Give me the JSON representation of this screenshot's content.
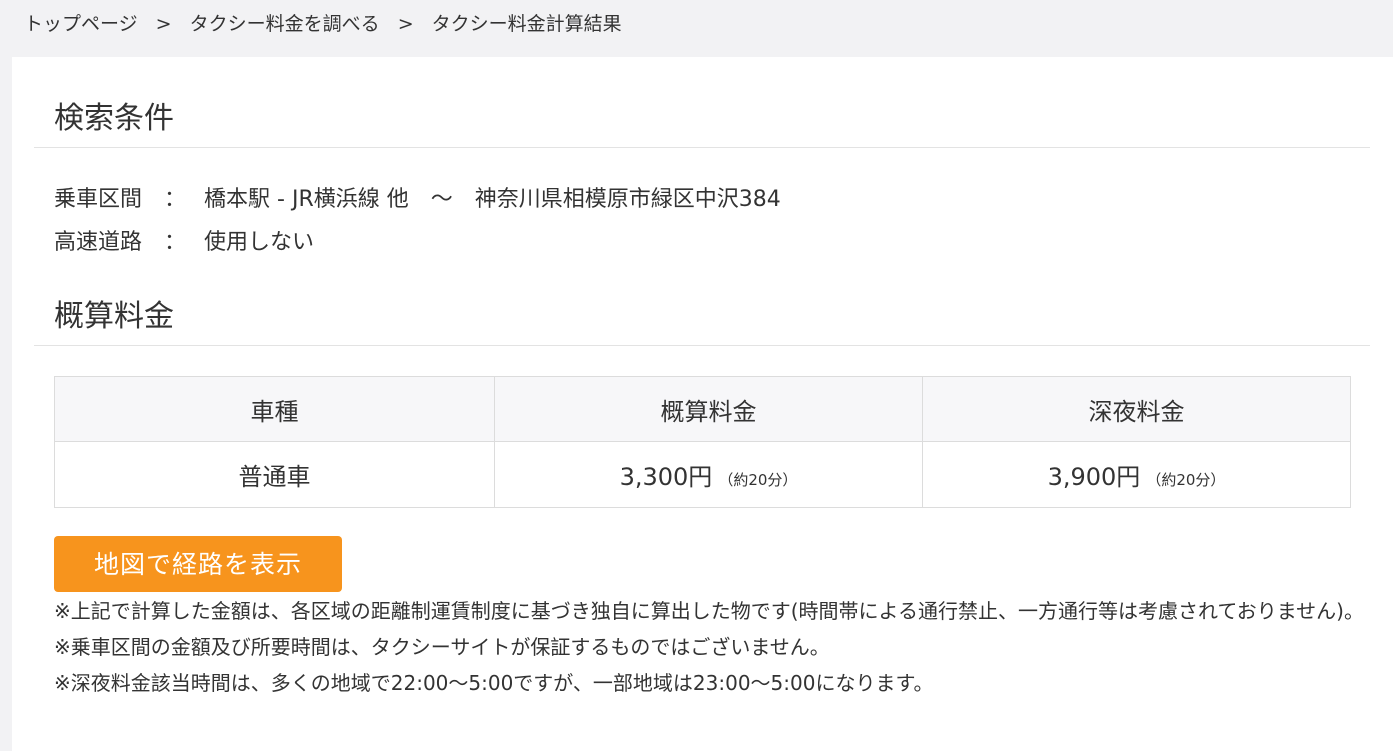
{
  "breadcrumb": {
    "items": [
      "トップページ",
      "タクシー料金を調べる",
      "タクシー料金計算結果"
    ],
    "separator": ">"
  },
  "search_conditions": {
    "title": "検索条件",
    "ride_section_label": "乗車区間",
    "ride_from": "橋本駅 - JR横浜線 他",
    "ride_tilde": "～",
    "ride_to": "神奈川県相模原市緑区中沢384",
    "expressway_label": "高速道路",
    "expressway_value": "使用しない",
    "colon": "："
  },
  "estimate": {
    "title": "概算料金",
    "headers": [
      "車種",
      "概算料金",
      "深夜料金"
    ],
    "rows": [
      {
        "vehicle": "普通車",
        "fare": "3,300円",
        "fare_note": "（約20分）",
        "night_fare": "3,900円",
        "night_note": "（約20分）"
      }
    ]
  },
  "map_button_label": "地図で経路を表示",
  "notes": [
    "※上記で計算した金額は、各区域の距離制運賃制度に基づき独自に算出した物です(時間帯による通行禁止、一方通行等は考慮されておりません)。",
    "※乗車区間の金額及び所要時間は、タクシーサイトが保証するものではございません。",
    "※深夜料金該当時間は、多くの地域で22:00～5:00ですが、一部地域は23:00～5:00になります。"
  ],
  "colors": {
    "accent": "#f7941d",
    "page_background": "#f2f2f4",
    "table_header_background": "#f7f7f9"
  }
}
